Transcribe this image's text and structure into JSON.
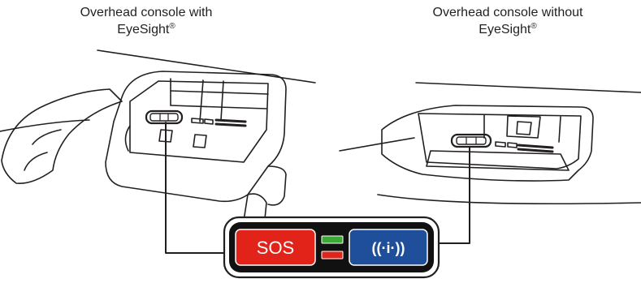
{
  "captions": {
    "left": {
      "line1": "Overhead console with",
      "line2": "EyeSight",
      "mark": "®"
    },
    "right": {
      "line1": "Overhead console without",
      "line2": "EyeSight",
      "mark": "®"
    }
  },
  "buttons": {
    "sos": {
      "label": "SOS",
      "color": "#e2231a"
    },
    "info": {
      "label": "((·i·))",
      "color": "#1f4f9b"
    }
  },
  "indicator": {
    "top_color": "#3aa935",
    "bottom_color": "#e2231a"
  },
  "icons": [
    "sos-button",
    "info-telematics-icon",
    "status-led-green",
    "status-led-red"
  ]
}
